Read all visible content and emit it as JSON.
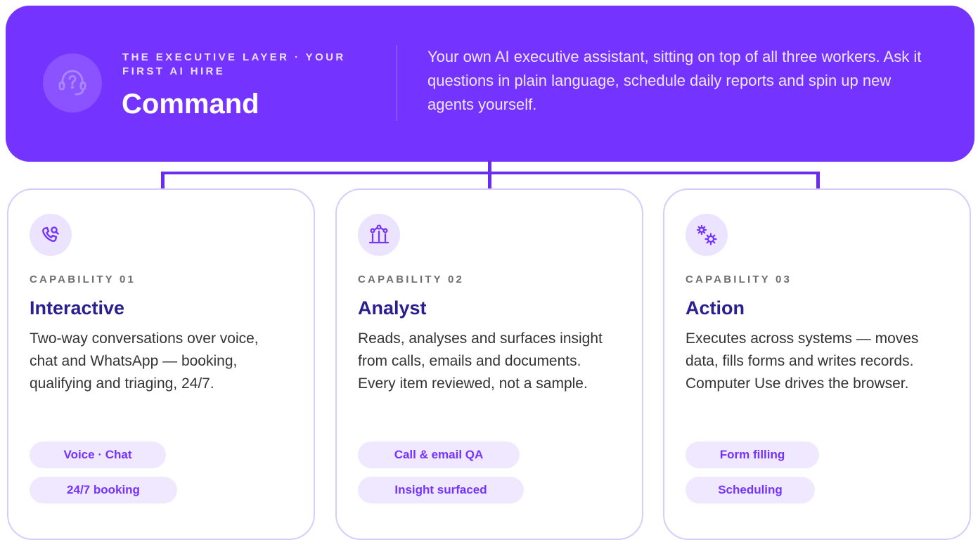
{
  "executive": {
    "kicker": "THE EXECUTIVE LAYER · YOUR FIRST AI HIRE",
    "title": "Command",
    "description": "Your own AI executive assistant, sitting on top of all three workers. Ask it questions in plain language, schedule daily reports and spin up new agents yourself.",
    "icon": "headset-question-icon"
  },
  "capabilities": [
    {
      "number": "CAPABILITY 01",
      "title": "Interactive",
      "description": "Two-way conversations over voice, chat and WhatsApp — booking, qualifying and triaging, 24/7.",
      "icon": "phone-search-icon",
      "tags": [
        "Voice · Chat",
        "24/7 booking"
      ]
    },
    {
      "number": "CAPABILITY 02",
      "title": "Analyst",
      "description": "Reads, analyses and surfaces insight from calls, emails and documents. Every item reviewed, not a sample.",
      "icon": "chart-nodes-icon",
      "tags": [
        "Call & email QA",
        "Insight surfaced"
      ]
    },
    {
      "number": "CAPABILITY 03",
      "title": "Action",
      "description": "Executes across systems — moves data, fills forms and writes records. Computer Use drives the browser.",
      "icon": "gears-icon",
      "tags": [
        "Form filling",
        "Scheduling"
      ]
    }
  ],
  "colors": {
    "brand": "#7433ff",
    "title": "#2a1f8f",
    "tag_bg": "#efe8ff",
    "card_border": "#d8ccff"
  }
}
